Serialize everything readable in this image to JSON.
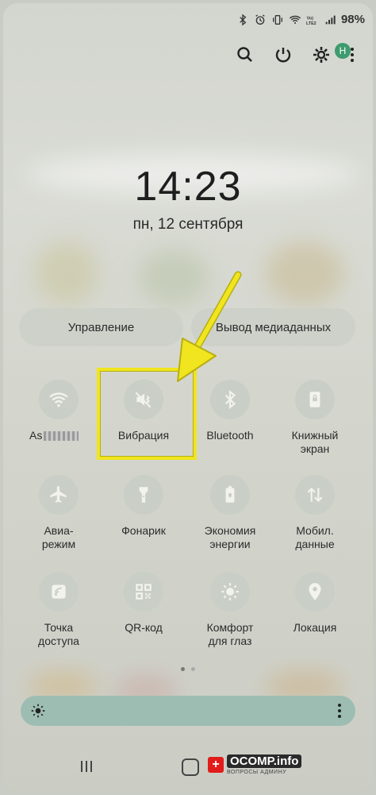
{
  "status_bar": {
    "battery": "98%"
  },
  "clock": {
    "time": "14:23",
    "date": "пн, 12 сентября"
  },
  "profile": {
    "initial": "Н"
  },
  "pills": {
    "control": "Управление",
    "media": "Вывод медиаданных"
  },
  "tiles": [
    {
      "label": "As",
      "icon": "wifi-icon",
      "state": "off"
    },
    {
      "label": "Вибрация",
      "icon": "vibrate-icon",
      "state": "off"
    },
    {
      "label": "Bluetooth",
      "icon": "bluetooth-icon",
      "state": "off"
    },
    {
      "label": "Книжный\nэкран",
      "icon": "portrait-lock-icon",
      "state": "off"
    },
    {
      "label": "Авиа-\nрежим",
      "icon": "airplane-icon",
      "state": "off"
    },
    {
      "label": "Фонарик",
      "icon": "flashlight-icon",
      "state": "off"
    },
    {
      "label": "Экономия\nэнергии",
      "icon": "battery-saver-icon",
      "state": "off"
    },
    {
      "label": "Мобил.\nданные",
      "icon": "mobile-data-icon",
      "state": "off"
    },
    {
      "label": "Точка\nдоступа",
      "icon": "hotspot-icon",
      "state": "off"
    },
    {
      "label": "QR-код",
      "icon": "qr-code-icon",
      "state": "off"
    },
    {
      "label": "Комфорт\nдля глаз",
      "icon": "eye-comfort-icon",
      "state": "off"
    },
    {
      "label": "Локация",
      "icon": "location-icon",
      "state": "off"
    }
  ],
  "watermark": {
    "name": "OCOMP.info",
    "tagline": "ВОПРОСЫ АДМИНУ"
  },
  "colors": {
    "highlight": "#f0e51e",
    "brightness_bar": "#9dbdb3",
    "profile": "#3d9b6e"
  }
}
